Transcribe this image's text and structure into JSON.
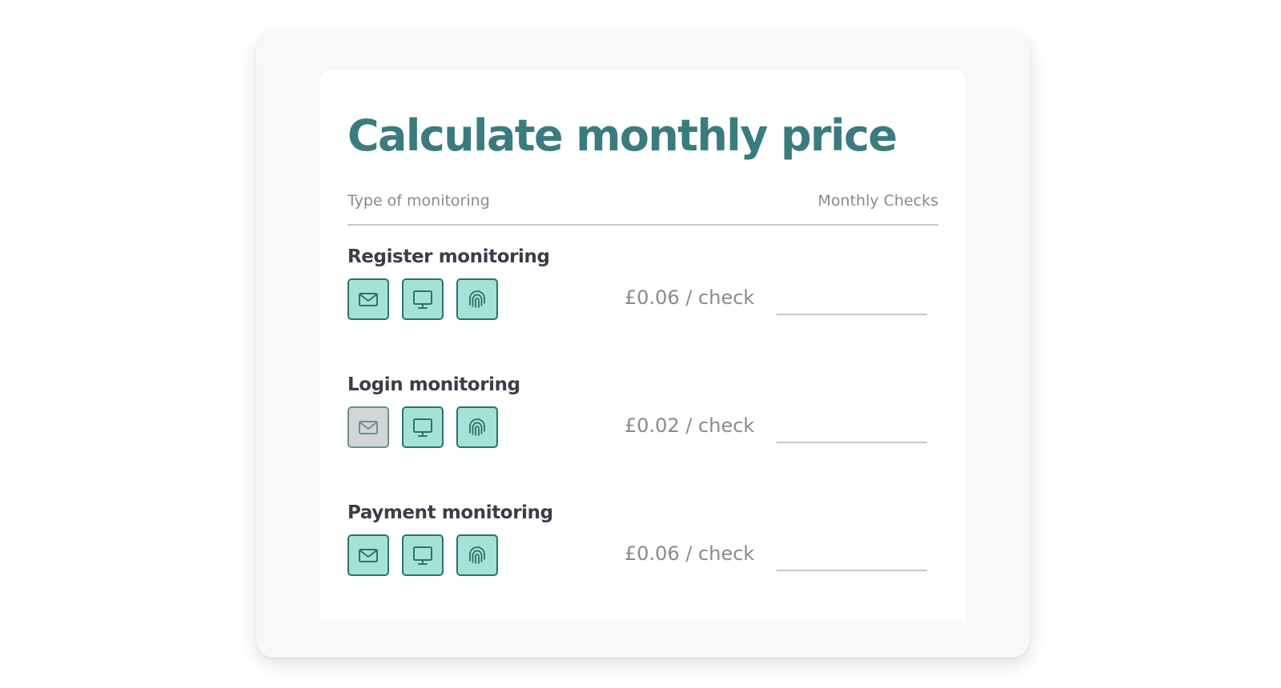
{
  "title": "Calculate monthly price",
  "header": {
    "type_label": "Type of monitoring",
    "checks_label": "Monthly Checks"
  },
  "rows": [
    {
      "title": "Register monitoring",
      "price": "£0.06 / check",
      "checks_value": "",
      "icons": [
        {
          "name": "envelope-icon",
          "active": true
        },
        {
          "name": "monitor-icon",
          "active": true
        },
        {
          "name": "fingerprint-icon",
          "active": true
        }
      ]
    },
    {
      "title": "Login monitoring",
      "price": "£0.02 / check",
      "checks_value": "",
      "icons": [
        {
          "name": "envelope-icon",
          "active": false
        },
        {
          "name": "monitor-icon",
          "active": true
        },
        {
          "name": "fingerprint-icon",
          "active": true
        }
      ]
    },
    {
      "title": "Payment monitoring",
      "price": "£0.06 / check",
      "checks_value": "",
      "icons": [
        {
          "name": "envelope-icon",
          "active": true
        },
        {
          "name": "monitor-icon",
          "active": true
        },
        {
          "name": "fingerprint-icon",
          "active": true
        }
      ]
    }
  ],
  "colors": {
    "title": "#3a7b80",
    "icon_active_fill": "#a3e3d6",
    "icon_active_border": "#2f7070",
    "icon_inactive_fill": "#d2d6d7",
    "row_title": "#3b3d48",
    "muted_text": "#8a8a8a"
  }
}
